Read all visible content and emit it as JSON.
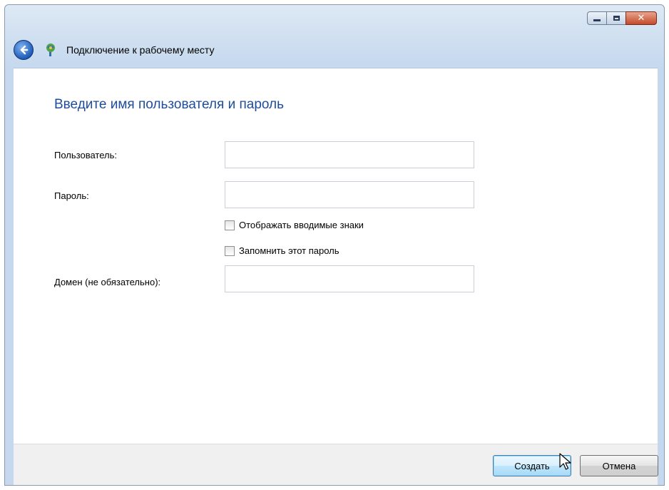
{
  "window": {
    "title": "Подключение к рабочему месту",
    "caption": {
      "minimize_icon": "minimize-icon",
      "maximize_icon": "maximize-icon",
      "close_icon": "close-icon",
      "close_glyph": "✕"
    }
  },
  "page": {
    "heading": "Введите имя пользователя и пароль"
  },
  "form": {
    "username_label": "Пользователь:",
    "username_value": "",
    "password_label": "Пароль:",
    "password_value": "",
    "show_chars_label": "Отображать вводимые знаки",
    "show_chars_checked": false,
    "remember_label": "Запомнить этот пароль",
    "remember_checked": false,
    "domain_label": "Домен (не обязательно):",
    "domain_value": ""
  },
  "buttons": {
    "create_label": "Создать",
    "cancel_label": "Отмена"
  },
  "colors": {
    "heading": "#1e4d9b",
    "default_button_border": "#3c7fb1"
  }
}
